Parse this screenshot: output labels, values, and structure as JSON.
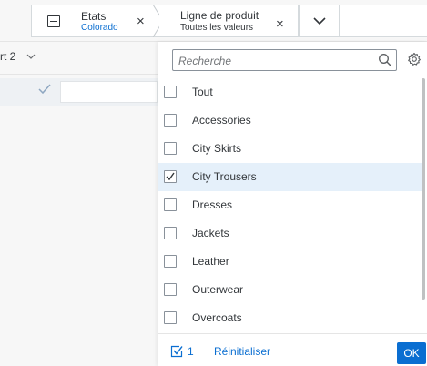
{
  "filters": {
    "states": {
      "label": "Etats",
      "value": "Colorado"
    },
    "product_line": {
      "label": "Ligne de produit",
      "value": "Toutes les valeurs"
    },
    "remove_glyph": "×"
  },
  "background": {
    "select_label": "rt 2"
  },
  "popover": {
    "search_placeholder": "Recherche",
    "items": [
      {
        "label": "Tout",
        "checked": false
      },
      {
        "label": "Accessories",
        "checked": false
      },
      {
        "label": "City Skirts",
        "checked": false
      },
      {
        "label": "City Trousers",
        "checked": true
      },
      {
        "label": "Dresses",
        "checked": false
      },
      {
        "label": "Jackets",
        "checked": false
      },
      {
        "label": "Leather",
        "checked": false
      },
      {
        "label": "Outerwear",
        "checked": false
      },
      {
        "label": "Overcoats",
        "checked": false
      }
    ],
    "footer": {
      "count": "1",
      "reset_label": "Réinitialiser",
      "ok_label": "OK"
    }
  },
  "colors": {
    "accent": "#0a6ed1",
    "selected_row": "#e5f0fa",
    "text": "#32363a"
  },
  "icons": [
    "collapse-icon",
    "close-icon",
    "chevron-down-icon",
    "search-icon",
    "settings-icon",
    "checkbox-icon",
    "checkmark-icon"
  ]
}
